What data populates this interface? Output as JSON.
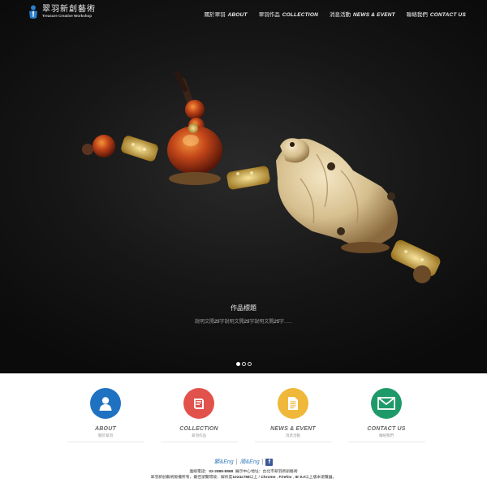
{
  "brand": {
    "name_cn": "翠羽新創藝術",
    "name_en": "Treasure Creative Workshop"
  },
  "nav": [
    {
      "cn": "關於翠羽",
      "en": "ABOUT"
    },
    {
      "cn": "翠羽作品",
      "en": "COLLECTION"
    },
    {
      "cn": "消息活動",
      "en": "NEWS & EVENT"
    },
    {
      "cn": "聯絡我們",
      "en": "CONTACT US"
    }
  ],
  "hero": {
    "title": "作品標題",
    "desc_parts": [
      "說明文開",
      "25",
      "字說明文開",
      "25",
      "字說明文開",
      "25",
      "字......"
    ],
    "slides": 3,
    "active_slide": 1
  },
  "features": [
    {
      "title": "ABOUT",
      "sub": "關於翠羽",
      "color": "#1f72c2",
      "icon": "user-icon"
    },
    {
      "title": "COLLECTION",
      "sub": "翠羽作品",
      "color": "#e2524c",
      "icon": "book-icon"
    },
    {
      "title": "NEWS & EVENT",
      "sub": "消息活動",
      "color": "#f0b83b",
      "icon": "document-icon"
    },
    {
      "title": "CONTACT US",
      "sub": "聯絡我們",
      "color": "#1e9a6a",
      "icon": "mail-icon"
    }
  ],
  "footer": {
    "lang1": "繁",
    "lang1b": "Eng",
    "lang2": "简",
    "lang2b": "Eng",
    "contact_label": "連絡電話：",
    "phone": "02-2888-8888",
    "address": "展示中心地址：台北市翠羽新創藝術",
    "copyright": "翠羽新創藝術版權所有，最佳瀏覽環境：解析度",
    "resolution": "1024x768",
    "above": "以上 /",
    "browser1": "Chrome",
    "browser2": "Firefox",
    "browser3": "IE 9.0",
    "above2": "以上版本瀏覽器。"
  }
}
